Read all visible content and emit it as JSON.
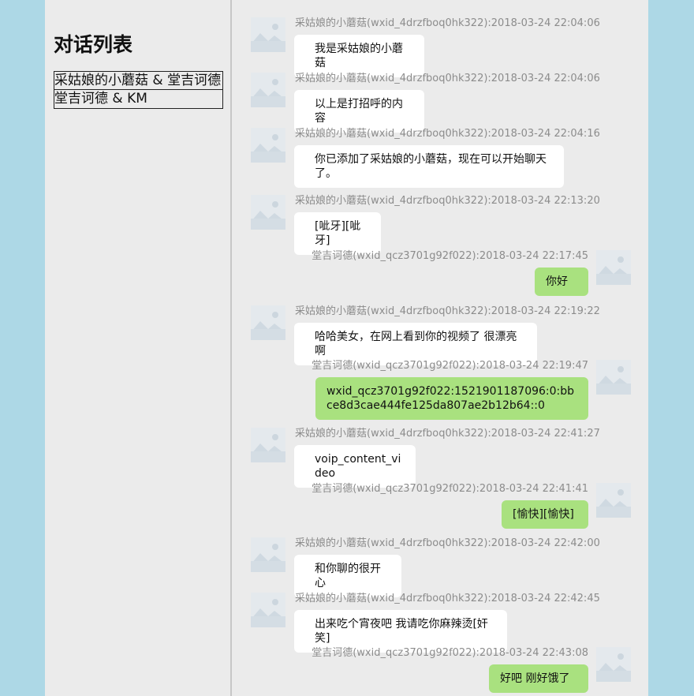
{
  "sidebar": {
    "title": "对话列表",
    "conversations": [
      "采姑娘的小蘑菇 & 堂吉诃德",
      "堂吉诃德 & KM"
    ]
  },
  "messages": [
    {
      "side": "left",
      "meta": "采姑娘的小蘑菇(wxid_4drzfboq0hk322):2018-03-24 22:04:06",
      "text": "我是采姑娘的小蘑菇"
    },
    {
      "side": "left",
      "meta": "采姑娘的小蘑菇(wxid_4drzfboq0hk322):2018-03-24 22:04:06",
      "text": "以上是打招呼的内容"
    },
    {
      "side": "left",
      "meta": "采姑娘的小蘑菇(wxid_4drzfboq0hk322):2018-03-24 22:04:16",
      "text": "你已添加了采姑娘的小蘑菇，现在可以开始聊天了。"
    },
    {
      "side": "left",
      "meta": "采姑娘的小蘑菇(wxid_4drzfboq0hk322):2018-03-24 22:13:20",
      "text": "[呲牙][呲牙]"
    },
    {
      "side": "right",
      "meta": "堂吉诃德(wxid_qcz3701g92f022):2018-03-24 22:17:45",
      "text": "你好"
    },
    {
      "side": "left",
      "meta": "采姑娘的小蘑菇(wxid_4drzfboq0hk322):2018-03-24 22:19:22",
      "text": "哈哈美女，在网上看到你的视频了 很漂亮啊"
    },
    {
      "side": "right",
      "meta": "堂吉诃德(wxid_qcz3701g92f022):2018-03-24 22:19:47",
      "text": "wxid_qcz3701g92f022:1521901187096:0:bbce8d3cae444fe125da807ae2b12b64::0"
    },
    {
      "side": "left",
      "meta": "采姑娘的小蘑菇(wxid_4drzfboq0hk322):2018-03-24 22:41:27",
      "text": "voip_content_video"
    },
    {
      "side": "right",
      "meta": "堂吉诃德(wxid_qcz3701g92f022):2018-03-24 22:41:41",
      "text": "[愉快][愉快]"
    },
    {
      "side": "left",
      "meta": "采姑娘的小蘑菇(wxid_4drzfboq0hk322):2018-03-24 22:42:00",
      "text": "和你聊的很开心"
    },
    {
      "side": "left",
      "meta": "采姑娘的小蘑菇(wxid_4drzfboq0hk322):2018-03-24 22:42:45",
      "text": "出来吃个宵夜吧 我请吃你麻辣烫[奸笑]"
    },
    {
      "side": "right",
      "meta": "堂吉诃德(wxid_qcz3701g92f022):2018-03-24 22:43:08",
      "text": "好吧 刚好饿了"
    }
  ],
  "avatar_placeholder_text": "图片无法显示",
  "colors": {
    "page_background": "#add8e6",
    "panel_background": "#ebebeb",
    "own_bubble": "#a9e17f",
    "other_bubble": "#ffffff",
    "meta_text": "#8c8c8c"
  }
}
